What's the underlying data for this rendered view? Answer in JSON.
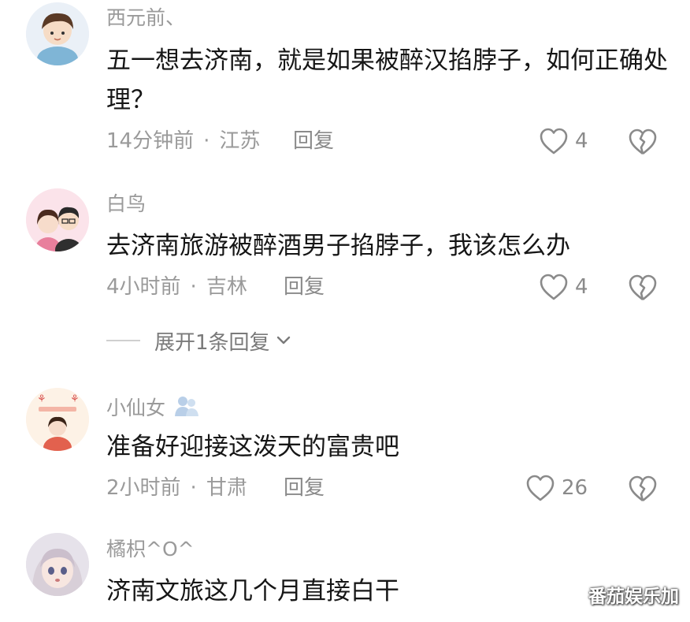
{
  "comments": [
    {
      "username": "西元前、",
      "text": "五一想去济南，就是如果被醉汉掐脖子，如何正确处理？",
      "time": "14分钟前",
      "location": "江苏",
      "reply_label": "回复",
      "likes": "4",
      "icons": {
        "like": "heart-outline-icon",
        "dislike": "broken-heart-icon"
      }
    },
    {
      "username": "白鸟",
      "text": "去济南旅游被醉酒男子掐脖子，我该怎么办",
      "time": "4小时前",
      "location": "吉林",
      "reply_label": "回复",
      "likes": "4",
      "expand_label": "展开1条回复"
    },
    {
      "username": "小仙女",
      "text": "准备好迎接这泼天的富贵吧",
      "time": "2小时前",
      "location": "甘肃",
      "reply_label": "回复",
      "likes": "26"
    },
    {
      "username": "橘枳^O^",
      "text": "济南文旅这几个月直接白干"
    }
  ],
  "meta_separator": "·",
  "watermark": "番茄娱乐加",
  "colors": {
    "secondary_text": "#9a9a9a",
    "primary_text": "#161616",
    "icon_stroke": "#8a8a8a"
  }
}
